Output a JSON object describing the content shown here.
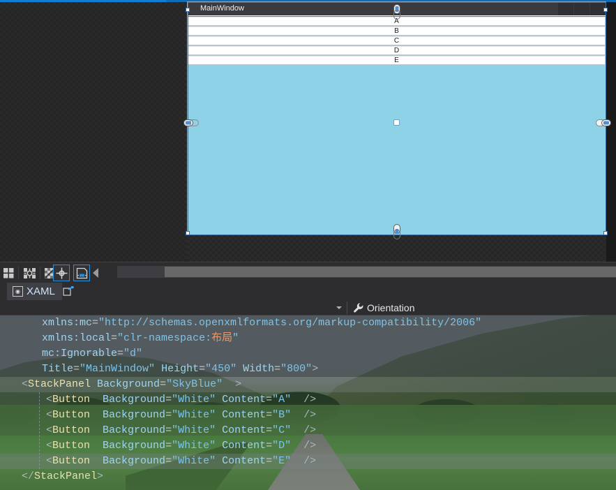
{
  "designer": {
    "window_title": "MainWindow",
    "window_buttons": [
      "minimize",
      "maximize",
      "close"
    ],
    "panel_background": "#8ed2e8",
    "panel_background_name": "SkyBlue",
    "buttons": [
      {
        "content": "A",
        "background": "White"
      },
      {
        "content": "B",
        "background": "White"
      },
      {
        "content": "C",
        "background": "White"
      },
      {
        "content": "D",
        "background": "White"
      },
      {
        "content": "E",
        "background": "White"
      }
    ],
    "handles": {
      "top_chain": "chain-link-vertical",
      "bottom_chain": "chain-link-vertical",
      "left_chain": "chain-link-horizontal",
      "right_chain": "chain-link-horizontal",
      "center": "center-anchor-dot"
    }
  },
  "designer_toolbar": {
    "buttons": [
      {
        "name": "grid-rail-icon",
        "active": false
      },
      {
        "name": "snaplines-icon",
        "active": false
      },
      {
        "name": "snap-to-grid-icon",
        "active": false
      },
      {
        "name": "effects-icon",
        "active": true
      },
      {
        "name": "save-designer-icon",
        "active": true
      }
    ],
    "collapse_label": "collapse-pane-arrow"
  },
  "tabs": {
    "items": [
      {
        "label": "XAML",
        "icon": "xaml-icon",
        "active": true
      }
    ],
    "new_window_icon": "pop-out-icon"
  },
  "property_bar": {
    "dropdown_icon": "chevron-down-icon",
    "wrench_icon": "wrench-icon",
    "label": "Orientation"
  },
  "editor": {
    "lines": [
      {
        "indent": 60,
        "tokens": [
          {
            "t": "xmlns:mc",
            "c": "attr"
          },
          {
            "t": "=",
            "c": "eq"
          },
          {
            "t": "\"http://schemas.openxmlformats.org/markup-compatibility/2006\"",
            "c": "str"
          }
        ]
      },
      {
        "indent": 60,
        "tokens": [
          {
            "t": "xmlns:local",
            "c": "attr"
          },
          {
            "t": "=",
            "c": "eq"
          },
          {
            "t": "\"clr-namespace:",
            "c": "str"
          },
          {
            "t": "布局",
            "c": "cjk"
          },
          {
            "t": "\"",
            "c": "str"
          }
        ]
      },
      {
        "indent": 60,
        "tokens": [
          {
            "t": "mc:Ignorable",
            "c": "attr"
          },
          {
            "t": "=",
            "c": "eq"
          },
          {
            "t": "\"d\"",
            "c": "str"
          }
        ]
      },
      {
        "indent": 60,
        "tokens": [
          {
            "t": "Title",
            "c": "attr"
          },
          {
            "t": "=",
            "c": "eq"
          },
          {
            "t": "\"MainWindow\"",
            "c": "str"
          },
          {
            "t": " ",
            "c": "eq"
          },
          {
            "t": "Height",
            "c": "attr"
          },
          {
            "t": "=",
            "c": "eq"
          },
          {
            "t": "\"450\"",
            "c": "str"
          },
          {
            "t": " ",
            "c": "eq"
          },
          {
            "t": "Width",
            "c": "attr"
          },
          {
            "t": "=",
            "c": "eq"
          },
          {
            "t": "\"800\"",
            "c": "str"
          },
          {
            "t": ">",
            "c": "brk"
          }
        ]
      },
      {
        "indent": 31,
        "highlight": true,
        "tokens": [
          {
            "t": "<",
            "c": "brk"
          },
          {
            "t": "StackPanel",
            "c": "tag"
          },
          {
            "t": " ",
            "c": "eq"
          },
          {
            "t": "Background",
            "c": "attr"
          },
          {
            "t": "=",
            "c": "eq"
          },
          {
            "t": "\"SkyBlue\"",
            "c": "str"
          },
          {
            "t": "  >",
            "c": "brk"
          }
        ]
      },
      {
        "indent": 66,
        "tokens": [
          {
            "t": "<",
            "c": "brk"
          },
          {
            "t": "Button",
            "c": "tag"
          },
          {
            "t": "  ",
            "c": "eq"
          },
          {
            "t": "Background",
            "c": "attr"
          },
          {
            "t": "=",
            "c": "eq"
          },
          {
            "t": "\"White\"",
            "c": "str"
          },
          {
            "t": " ",
            "c": "eq"
          },
          {
            "t": "Content",
            "c": "attr"
          },
          {
            "t": "=",
            "c": "eq"
          },
          {
            "t": "\"A\"",
            "c": "str"
          },
          {
            "t": "  />",
            "c": "brk"
          }
        ]
      },
      {
        "indent": 66,
        "tokens": [
          {
            "t": "<",
            "c": "brk"
          },
          {
            "t": "Button",
            "c": "tag"
          },
          {
            "t": "  ",
            "c": "eq"
          },
          {
            "t": "Background",
            "c": "attr"
          },
          {
            "t": "=",
            "c": "eq"
          },
          {
            "t": "\"White\"",
            "c": "str"
          },
          {
            "t": " ",
            "c": "eq"
          },
          {
            "t": "Content",
            "c": "attr"
          },
          {
            "t": "=",
            "c": "eq"
          },
          {
            "t": "\"B\"",
            "c": "str"
          },
          {
            "t": "  />",
            "c": "brk"
          }
        ]
      },
      {
        "indent": 66,
        "tokens": [
          {
            "t": "<",
            "c": "brk"
          },
          {
            "t": "Button",
            "c": "tag"
          },
          {
            "t": "  ",
            "c": "eq"
          },
          {
            "t": "Background",
            "c": "attr"
          },
          {
            "t": "=",
            "c": "eq"
          },
          {
            "t": "\"White\"",
            "c": "str"
          },
          {
            "t": " ",
            "c": "eq"
          },
          {
            "t": "Content",
            "c": "attr"
          },
          {
            "t": "=",
            "c": "eq"
          },
          {
            "t": "\"C\"",
            "c": "str"
          },
          {
            "t": "  />",
            "c": "brk"
          }
        ]
      },
      {
        "indent": 66,
        "tokens": [
          {
            "t": "<",
            "c": "brk"
          },
          {
            "t": "Button",
            "c": "tag"
          },
          {
            "t": "  ",
            "c": "eq"
          },
          {
            "t": "Background",
            "c": "attr"
          },
          {
            "t": "=",
            "c": "eq"
          },
          {
            "t": "\"White\"",
            "c": "str"
          },
          {
            "t": " ",
            "c": "eq"
          },
          {
            "t": "Content",
            "c": "attr"
          },
          {
            "t": "=",
            "c": "eq"
          },
          {
            "t": "\"D\"",
            "c": "str"
          },
          {
            "t": "  />",
            "c": "brk"
          }
        ]
      },
      {
        "indent": 66,
        "highlight": true,
        "tokens": [
          {
            "t": "<",
            "c": "brk"
          },
          {
            "t": "Button",
            "c": "tag"
          },
          {
            "t": "  ",
            "c": "eq"
          },
          {
            "t": "Background",
            "c": "attr"
          },
          {
            "t": "=",
            "c": "eq"
          },
          {
            "t": "\"White\"",
            "c": "str"
          },
          {
            "t": " ",
            "c": "eq"
          },
          {
            "t": "Content",
            "c": "attr"
          },
          {
            "t": "=",
            "c": "eq"
          },
          {
            "t": "\"E\"",
            "c": "str"
          },
          {
            "t": "  />",
            "c": "brk"
          }
        ]
      },
      {
        "indent": 31,
        "tokens": [
          {
            "t": "</",
            "c": "brk"
          },
          {
            "t": "StackPanel",
            "c": "tag"
          },
          {
            "t": ">",
            "c": "brk"
          }
        ]
      }
    ]
  }
}
